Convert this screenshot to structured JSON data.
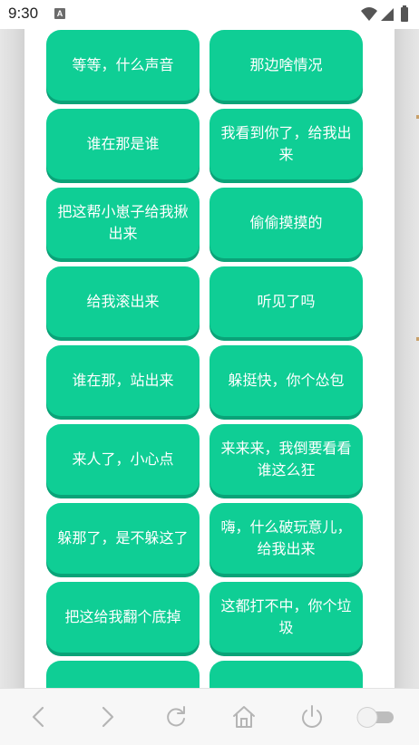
{
  "status_bar": {
    "time": "9:30",
    "notification_letter": "A",
    "icons": [
      "wifi-icon",
      "signal-icon",
      "battery-icon"
    ]
  },
  "sound_buttons": [
    {
      "label": "等等，什么声音"
    },
    {
      "label": "那边啥情况"
    },
    {
      "label": "谁在那是谁"
    },
    {
      "label": "我看到你了，给我出来"
    },
    {
      "label": "把这帮小崽子给我揪出来"
    },
    {
      "label": "偷偷摸摸的"
    },
    {
      "label": "给我滚出来"
    },
    {
      "label": "听见了吗"
    },
    {
      "label": "谁在那，站出来"
    },
    {
      "label": "躲挺快，你个怂包"
    },
    {
      "label": "来人了，小心点"
    },
    {
      "label": "来来来，我倒要看看谁这么狂"
    },
    {
      "label": "躲那了，是不躲这了"
    },
    {
      "label": "嗨，什么破玩意儿，给我出来"
    },
    {
      "label": "把这给我翻个底掉"
    },
    {
      "label": "这都打不中，你个垃圾"
    },
    {
      "label": ""
    },
    {
      "label": ""
    }
  ],
  "nav_bar": {
    "icons": [
      "back-icon",
      "forward-icon",
      "reload-icon",
      "home-icon",
      "power-icon",
      "toggle-switch"
    ]
  },
  "colors": {
    "button": "#0fce95",
    "button_shadow": "#0aa378",
    "text": "#ffffff"
  }
}
